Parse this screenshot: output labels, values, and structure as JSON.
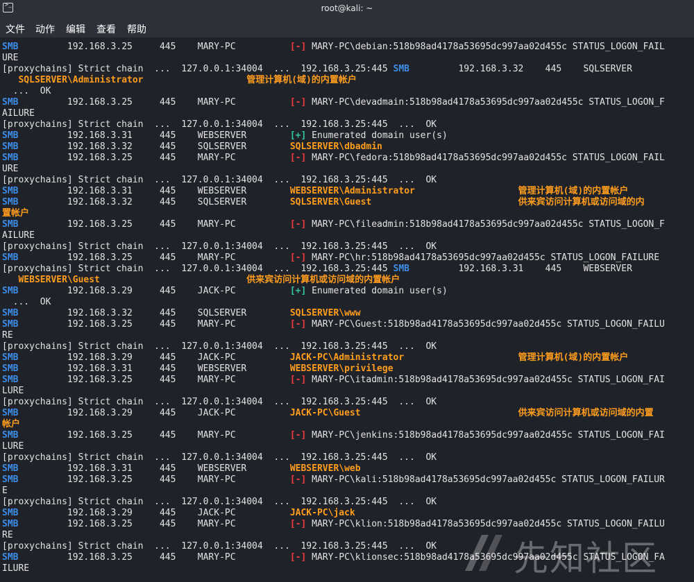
{
  "window": {
    "title": "root@kali: ~"
  },
  "menu": [
    "文件",
    "动作",
    "编辑",
    "查看",
    "帮助"
  ],
  "watermark": {
    "text": "先知社区"
  },
  "colors": {
    "smb": "#3e8ee8",
    "fail": "#ef3b3b",
    "success": "#33c6a5",
    "highlight": "#ff9d1c",
    "text": "#e3e3e3",
    "background": "#202229"
  },
  "lines": [
    [
      [
        "smb",
        "SMB"
      ],
      [
        "w",
        "         192.168.3.25     445    MARY-PC          "
      ],
      [
        "minus",
        "[-]"
      ],
      [
        "w",
        " MARY-PC\\debian:518b98ad4178a53695dc997aa02d455c STATUS_LOGON_FAIL"
      ]
    ],
    [
      [
        "w",
        "URE"
      ]
    ],
    [
      [
        "w",
        "[proxychains] Strict chain  ...  127.0.0.1:34004  ...  192.168.3.25:445 "
      ],
      [
        "smb",
        "SMB"
      ],
      [
        "w",
        "         192.168.3.32    445    SQLSERVER"
      ]
    ],
    [
      [
        "w",
        "   "
      ],
      [
        "orange",
        "SQLSERVER\\Administrator"
      ],
      [
        "w",
        "                   "
      ],
      [
        "orange",
        "管理计算机(域)的内置帐户"
      ]
    ],
    [
      [
        "w",
        "  ...  OK"
      ]
    ],
    [
      [
        "smb",
        "SMB"
      ],
      [
        "w",
        "         192.168.3.25     445    MARY-PC          "
      ],
      [
        "minus",
        "[-]"
      ],
      [
        "w",
        " MARY-PC\\devadmain:518b98ad4178a53695dc997aa02d455c STATUS_LOGON_F"
      ]
    ],
    [
      [
        "w",
        "AILURE"
      ]
    ],
    [
      [
        "w",
        "[proxychains] Strict chain  ...  127.0.0.1:34004  ...  192.168.3.25:445  ...  OK"
      ]
    ],
    [
      [
        "smb",
        "SMB"
      ],
      [
        "w",
        "         192.168.3.31     445    WEBSERVER        "
      ],
      [
        "plus",
        "[+]"
      ],
      [
        "w",
        " Enumerated domain user(s)"
      ]
    ],
    [
      [
        "smb",
        "SMB"
      ],
      [
        "w",
        "         192.168.3.32     445    SQLSERVER        "
      ],
      [
        "orange",
        "SQLSERVER\\dbadmin"
      ]
    ],
    [
      [
        "smb",
        "SMB"
      ],
      [
        "w",
        "         192.168.3.25     445    MARY-PC          "
      ],
      [
        "minus",
        "[-]"
      ],
      [
        "w",
        " MARY-PC\\fedora:518b98ad4178a53695dc997aa02d455c STATUS_LOGON_FAIL"
      ]
    ],
    [
      [
        "w",
        "URE"
      ]
    ],
    [
      [
        "w",
        "[proxychains] Strict chain  ...  127.0.0.1:34004  ...  192.168.3.25:445  ...  OK"
      ]
    ],
    [
      [
        "smb",
        "SMB"
      ],
      [
        "w",
        "         192.168.3.31     445    WEBSERVER        "
      ],
      [
        "orange",
        "WEBSERVER\\Administrator"
      ],
      [
        "w",
        "                   "
      ],
      [
        "orange",
        "管理计算机(域)的内置帐户"
      ]
    ],
    [
      [
        "smb",
        "SMB"
      ],
      [
        "w",
        "         192.168.3.32     445    SQLSERVER        "
      ],
      [
        "orange",
        "SQLSERVER\\Guest"
      ],
      [
        "w",
        "                           "
      ],
      [
        "orange",
        "供来宾访问计算机或访问域的内"
      ]
    ],
    [
      [
        "orange",
        "置帐户"
      ]
    ],
    [
      [
        "smb",
        "SMB"
      ],
      [
        "w",
        "         192.168.3.25     445    MARY-PC          "
      ],
      [
        "minus",
        "[-]"
      ],
      [
        "w",
        " MARY-PC\\fileadmin:518b98ad4178a53695dc997aa02d455c STATUS_LOGON_F"
      ]
    ],
    [
      [
        "w",
        "AILURE"
      ]
    ],
    [
      [
        "w",
        "[proxychains] Strict chain  ...  127.0.0.1:34004  ...  192.168.3.25:445  ...  OK"
      ]
    ],
    [
      [
        "smb",
        "SMB"
      ],
      [
        "w",
        "         192.168.3.25     445    MARY-PC          "
      ],
      [
        "minus",
        "[-]"
      ],
      [
        "w",
        " MARY-PC\\hr:518b98ad4178a53695dc997aa02d455c STATUS_LOGON_FAILURE"
      ]
    ],
    [
      [
        "w",
        "[proxychains] Strict chain  ...  127.0.0.1:34004  ...  192.168.3.25:445 "
      ],
      [
        "smb",
        "SMB"
      ],
      [
        "w",
        "         192.168.3.31    445    WEBSERVER"
      ]
    ],
    [
      [
        "w",
        "   "
      ],
      [
        "orange",
        "WEBSERVER\\Guest"
      ],
      [
        "w",
        "                           "
      ],
      [
        "orange",
        "供来宾访问计算机或访问域的内置帐户"
      ]
    ],
    [
      [
        "smb",
        "SMB"
      ],
      [
        "w",
        "         192.168.3.29     445    JACK-PC          "
      ],
      [
        "plus",
        "[+]"
      ],
      [
        "w",
        " Enumerated domain user(s)"
      ]
    ],
    [
      [
        "w",
        "  ...  OK"
      ]
    ],
    [
      [
        "smb",
        "SMB"
      ],
      [
        "w",
        "         192.168.3.32     445    SQLSERVER        "
      ],
      [
        "orange",
        "SQLSERVER\\www"
      ]
    ],
    [
      [
        "smb",
        "SMB"
      ],
      [
        "w",
        "         192.168.3.25     445    MARY-PC          "
      ],
      [
        "minus",
        "[-]"
      ],
      [
        "w",
        " MARY-PC\\Guest:518b98ad4178a53695dc997aa02d455c STATUS_LOGON_FAILU"
      ]
    ],
    [
      [
        "w",
        "RE"
      ]
    ],
    [
      [
        "w",
        "[proxychains] Strict chain  ...  127.0.0.1:34004  ...  192.168.3.25:445  ...  OK"
      ]
    ],
    [
      [
        "smb",
        "SMB"
      ],
      [
        "w",
        "         192.168.3.29     445    JACK-PC          "
      ],
      [
        "orange",
        "JACK-PC\\Administrator"
      ],
      [
        "w",
        "                     "
      ],
      [
        "orange",
        "管理计算机(域)的内置帐户"
      ]
    ],
    [
      [
        "smb",
        "SMB"
      ],
      [
        "w",
        "         192.168.3.31     445    WEBSERVER        "
      ],
      [
        "orange",
        "WEBSERVER\\privilege"
      ]
    ],
    [
      [
        "smb",
        "SMB"
      ],
      [
        "w",
        "         192.168.3.25     445    MARY-PC          "
      ],
      [
        "minus",
        "[-]"
      ],
      [
        "w",
        " MARY-PC\\itadmin:518b98ad4178a53695dc997aa02d455c STATUS_LOGON_FAI"
      ]
    ],
    [
      [
        "w",
        "LURE"
      ]
    ],
    [
      [
        "w",
        "[proxychains] Strict chain  ...  127.0.0.1:34004  ...  192.168.3.25:445  ...  OK"
      ]
    ],
    [
      [
        "smb",
        "SMB"
      ],
      [
        "w",
        "         192.168.3.29     445    JACK-PC          "
      ],
      [
        "orange",
        "JACK-PC\\Guest"
      ],
      [
        "w",
        "                             "
      ],
      [
        "orange",
        "供来宾访问计算机或访问域的内置"
      ]
    ],
    [
      [
        "orange",
        "帐户"
      ]
    ],
    [
      [
        "smb",
        "SMB"
      ],
      [
        "w",
        "         192.168.3.25     445    MARY-PC          "
      ],
      [
        "minus",
        "[-]"
      ],
      [
        "w",
        " MARY-PC\\jenkins:518b98ad4178a53695dc997aa02d455c STATUS_LOGON_FAI"
      ]
    ],
    [
      [
        "w",
        "LURE"
      ]
    ],
    [
      [
        "w",
        "[proxychains] Strict chain  ...  127.0.0.1:34004  ...  192.168.3.25:445  ...  OK"
      ]
    ],
    [
      [
        "smb",
        "SMB"
      ],
      [
        "w",
        "         192.168.3.31     445    WEBSERVER        "
      ],
      [
        "orange",
        "WEBSERVER\\web"
      ]
    ],
    [
      [
        "smb",
        "SMB"
      ],
      [
        "w",
        "         192.168.3.25     445    MARY-PC          "
      ],
      [
        "minus",
        "[-]"
      ],
      [
        "w",
        " MARY-PC\\kali:518b98ad4178a53695dc997aa02d455c STATUS_LOGON_FAILUR"
      ]
    ],
    [
      [
        "w",
        "E"
      ]
    ],
    [
      [
        "w",
        "[proxychains] Strict chain  ...  127.0.0.1:34004  ...  192.168.3.25:445  ...  OK"
      ]
    ],
    [
      [
        "smb",
        "SMB"
      ],
      [
        "w",
        "         192.168.3.29     445    JACK-PC          "
      ],
      [
        "orange",
        "JACK-PC\\jack"
      ]
    ],
    [
      [
        "smb",
        "SMB"
      ],
      [
        "w",
        "         192.168.3.25     445    MARY-PC          "
      ],
      [
        "minus",
        "[-]"
      ],
      [
        "w",
        " MARY-PC\\klion:518b98ad4178a53695dc997aa02d455c STATUS_LOGON_FAILU"
      ]
    ],
    [
      [
        "w",
        "RE"
      ]
    ],
    [
      [
        "w",
        "[proxychains] Strict chain  ...  127.0.0.1:34004  ...  192.168.3.25:445  ...  OK"
      ]
    ],
    [
      [
        "smb",
        "SMB"
      ],
      [
        "w",
        "         192.168.3.25     445    MARY-PC          "
      ],
      [
        "minus",
        "[-]"
      ],
      [
        "w",
        " MARY-PC\\klionsec:518b98ad4178a53695dc997aa02d455c STATUS_LOGON_FA"
      ]
    ],
    [
      [
        "w",
        "ILURE"
      ]
    ]
  ]
}
